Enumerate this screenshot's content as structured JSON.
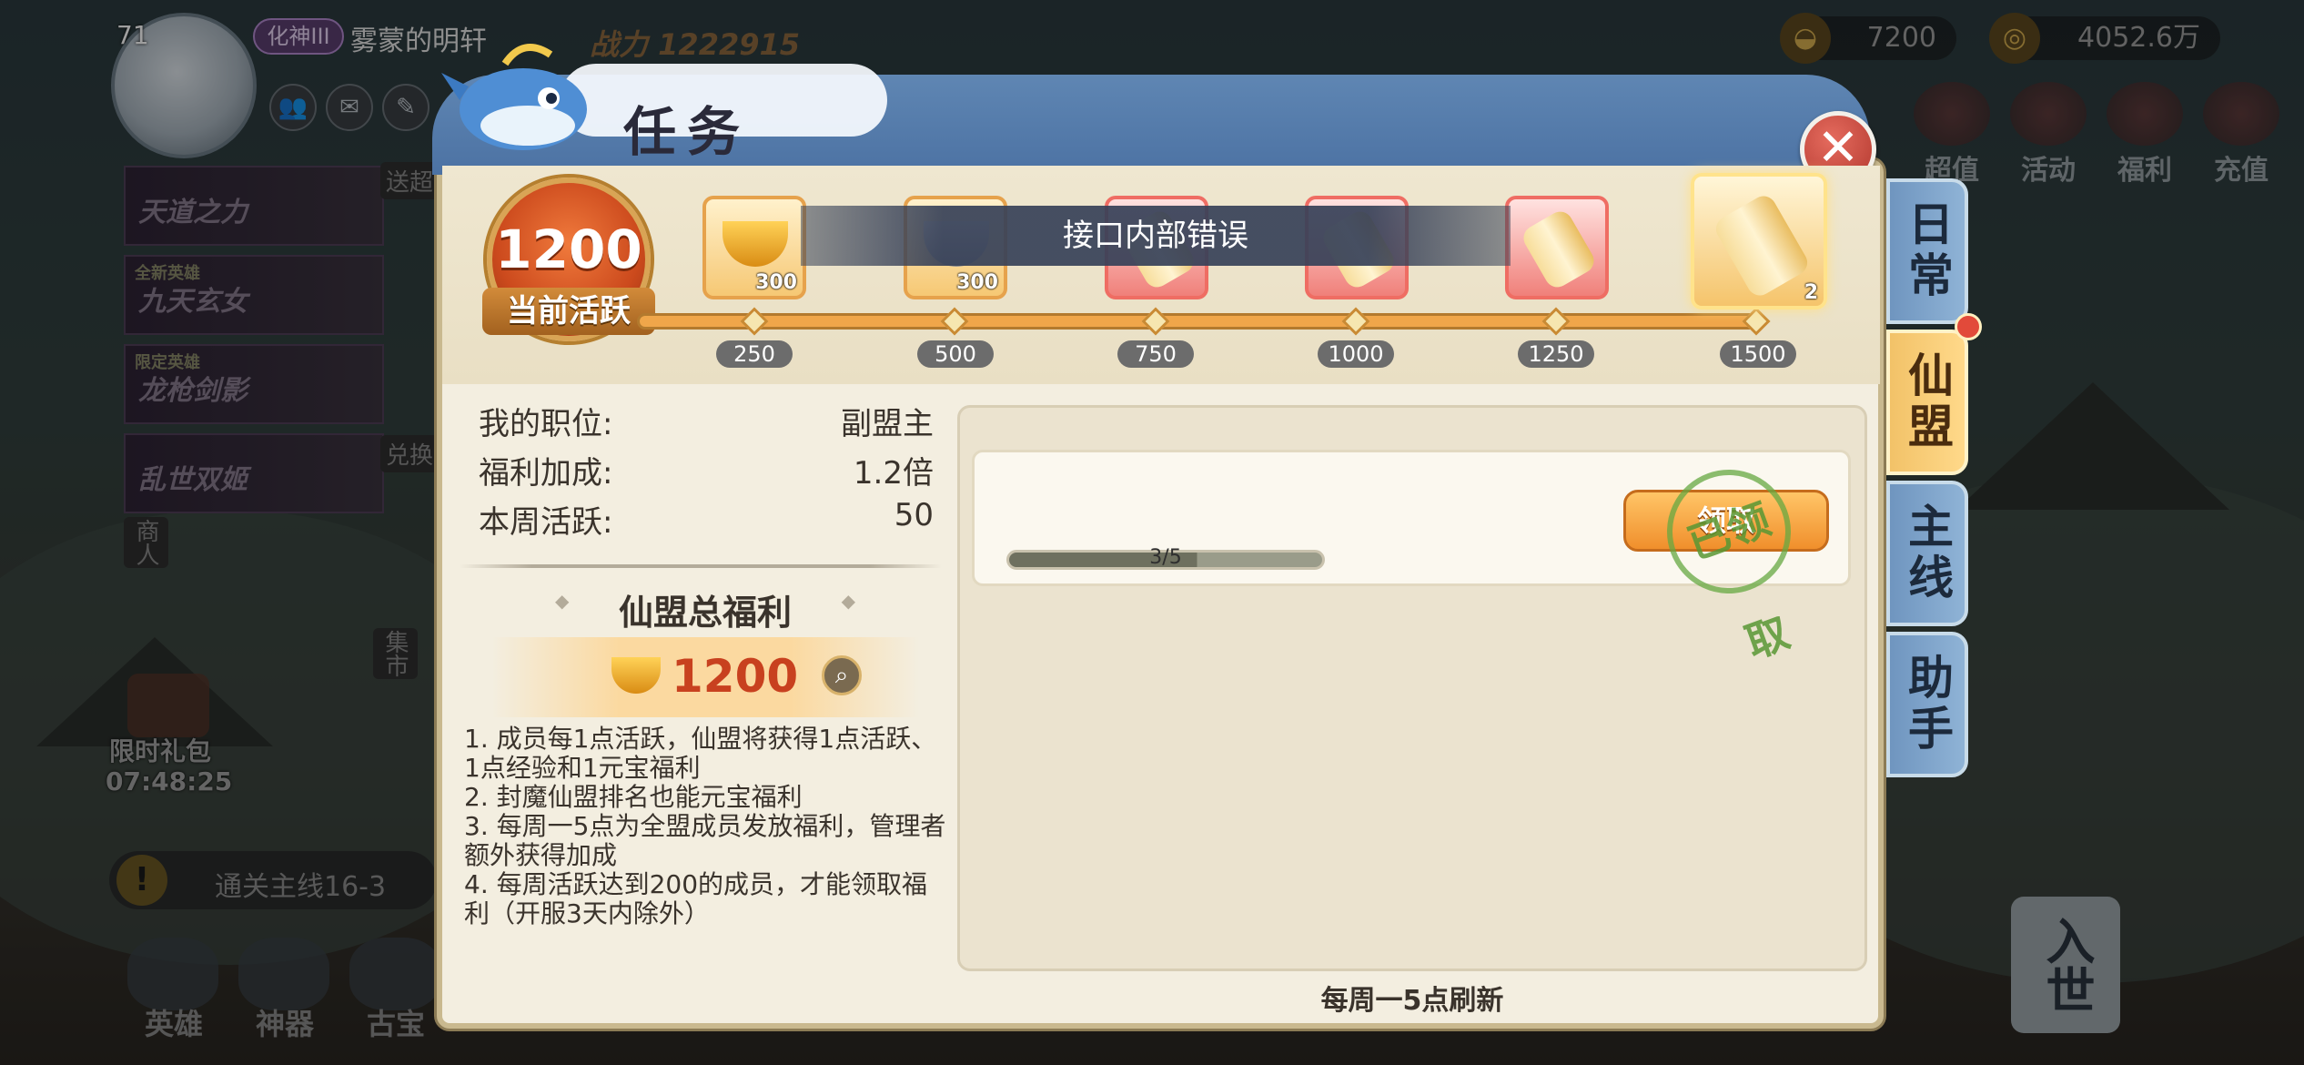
{
  "player": {
    "level": "71",
    "rank": "化神III",
    "name": "雾蒙的明轩",
    "power_label": "战力",
    "power_value": "1222915"
  },
  "currencies": [
    {
      "icon": "ingot-icon",
      "value": "7200"
    },
    {
      "icon": "gold-coin-icon",
      "value": "4052.6万"
    }
  ],
  "right_menu": [
    "超值",
    "活动",
    "福利",
    "充值"
  ],
  "left_banners": [
    "天道之力",
    "九天玄女",
    "龙枪剑影",
    "乱世双姬"
  ],
  "left_banner_tags": [
    "全新英雄",
    "限定英雄"
  ],
  "left_side_labels": {
    "send": "送超",
    "exchange": "兑换",
    "merchant": "商人",
    "market": "集市"
  },
  "gift": {
    "label": "限时礼包",
    "timer": "07:48:25"
  },
  "quest_hint": "通关主线16-3",
  "bottom_nav": [
    "英雄",
    "神器",
    "古宝",
    "入世"
  ],
  "panel": {
    "title": "任务",
    "close_label": "✕",
    "activity_value": "1200",
    "activity_label": "当前活跃",
    "error_message": "接口内部错误",
    "milestones": [
      "250",
      "500",
      "750",
      "1000",
      "1250",
      "1500"
    ],
    "rewards": [
      {
        "type": "gold-ingot",
        "qty": "300"
      },
      {
        "type": "silver-ingot",
        "qty": "300"
      },
      {
        "type": "scroll",
        "qty": ""
      },
      {
        "type": "scroll",
        "qty": ""
      },
      {
        "type": "scroll",
        "qty": ""
      },
      {
        "type": "scroll",
        "qty": "2"
      }
    ]
  },
  "info": {
    "position_label": "我的职位:",
    "position_value": "副盟主",
    "bonus_label": "福利加成:",
    "bonus_value": "1.2倍",
    "weekly_label": "本周活跃:",
    "weekly_value": "50",
    "total_title": "仙盟总福利",
    "total_value": "1200",
    "rules": [
      "1. 成员每1点活跃，仙盟将获得1点活跃、1点经验和1元宝福利",
      "2. 封魔仙盟排名也能元宝福利",
      "3. 每周一5点为全盟成员发放福利，管理者额外获得加成",
      "4. 每周活跃达到200的成员，才能领取福利（开服3天内除外）"
    ]
  },
  "task": {
    "progress_text": "3/5",
    "progress_fraction": 0.6,
    "claim_label": "领取",
    "stamp_text": "已领取"
  },
  "refresh_text": "每周一5点刷新",
  "tabs": [
    "日常",
    "仙盟",
    "主线",
    "助手"
  ],
  "active_tab": "仙盟",
  "colors": {
    "accent_orange": "#f08f2c",
    "error_red": "#c8411f",
    "tab_blue": "#8fb3d6",
    "tab_active": "#ffd98a"
  }
}
